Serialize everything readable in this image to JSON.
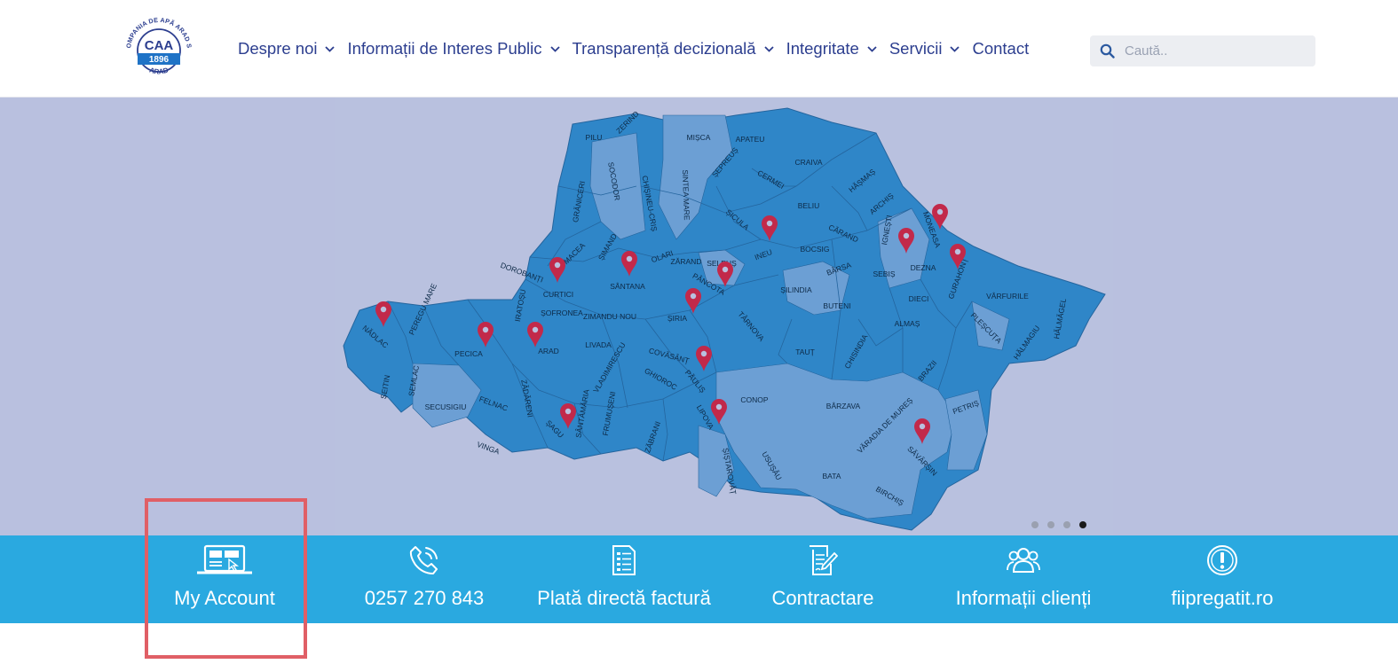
{
  "logo": {
    "top_text": "COMPANIA DE APĂ ARAD SA",
    "center_text": "CAA",
    "year": "1896",
    "bottom_text": "ARAD"
  },
  "nav": {
    "items": [
      {
        "label": "Despre noi",
        "has_dropdown": true
      },
      {
        "label": "Informații de Interes Public",
        "has_dropdown": true
      },
      {
        "label": "Transparență decizională",
        "has_dropdown": true
      },
      {
        "label": "Integritate",
        "has_dropdown": true
      },
      {
        "label": "Servicii",
        "has_dropdown": true
      },
      {
        "label": "Contact",
        "has_dropdown": false
      }
    ]
  },
  "search": {
    "placeholder": "Caută.."
  },
  "map": {
    "localities": [
      "PILU",
      "ZERIND",
      "MIȘCA",
      "APATEU",
      "CRAIVA",
      "ȘEPREUȘ",
      "CERMEI",
      "HĂȘMAȘ",
      "ARCHIȘ",
      "BELIU",
      "GRĂNICERI",
      "SOCODOR",
      "CHIȘINEU-CRIȘ",
      "SINTEA MARE",
      "ȘICULA",
      "INEU",
      "BOCSIG",
      "CĂRAND",
      "IGNEȘTI",
      "MONEASA",
      "DEZNA",
      "GURAHONȚ",
      "MACEA",
      "ȘIMAND",
      "OLARI",
      "ZĂRAND",
      "SELEUȘ",
      "BÂRSA",
      "SEBIȘ",
      "DOROBANȚI",
      "CURTICI",
      "SÂNTANA",
      "PÂNCOTA",
      "ȘILINDIA",
      "BUTENI",
      "DIECI",
      "VÂRFURILE",
      "HĂLMĂGEL",
      "PEREGU MARE",
      "IRATOȘU",
      "ȘOFRONEA",
      "ZIMANDU NOU",
      "ȘIRIA",
      "TÂRNOVA",
      "ALMAȘ",
      "PLEȘCUȚA",
      "NĂDLAC",
      "PECICA",
      "ARAD",
      "LIVADA",
      "COVĂSÂNȚ",
      "TAUȚ",
      "CHISINDIA",
      "HĂLMAGIU",
      "ȘEITIN",
      "SEMLAC",
      "ZĂDĂRENI",
      "VLADIMIRESCU",
      "GHIOROC",
      "PĂULIȘ",
      "BRAZII",
      "SECUSIGIU",
      "FELNAC",
      "CONOP",
      "BÂRZAVA",
      "PETRIȘ",
      "ȘAGU",
      "SÂNTĂMĂRIA",
      "FRUMUȘENI",
      "LIPOVA",
      "VINGA",
      "ZĂBRANI",
      "VĂRADIA DE MUREȘ",
      "SĂVÂRȘIN",
      "ȘIȘTAROVĂȚ",
      "USUȘĂU",
      "BATA",
      "BIRCHIȘ"
    ],
    "slides": 4,
    "active_slide": 4
  },
  "services": [
    {
      "label": "My Account",
      "icon": "laptop-account-icon"
    },
    {
      "label": "0257 270 843",
      "icon": "phone-icon"
    },
    {
      "label": "Plată directă factură",
      "icon": "invoice-icon"
    },
    {
      "label": "Contractare",
      "icon": "contract-icon"
    },
    {
      "label": "Informații clienți",
      "icon": "users-icon"
    },
    {
      "label": "fiipregatit.ro",
      "icon": "alert-icon"
    }
  ],
  "colors": {
    "brand_blue": "#2c3e8f",
    "service_bar": "#2aa9e0",
    "map_dark": "#2f86c8",
    "map_light": "#6c9fd4",
    "pin": "#c2294a",
    "highlight": "#e05f66"
  }
}
